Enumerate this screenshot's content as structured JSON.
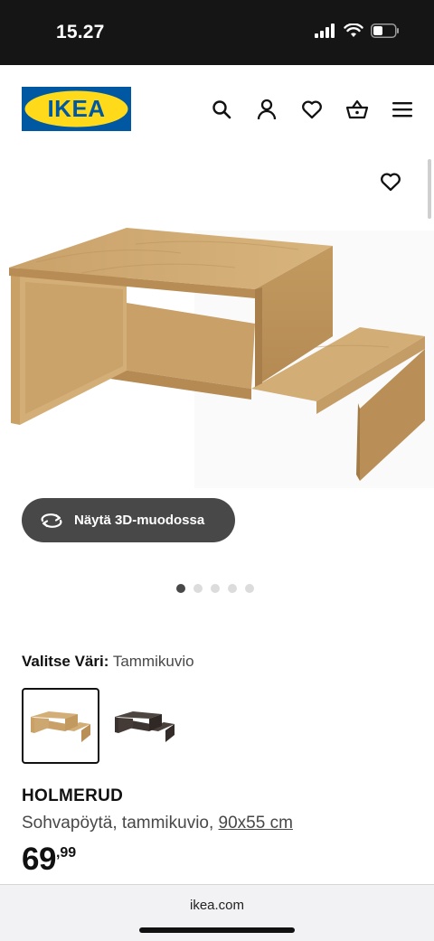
{
  "status_bar": {
    "time": "15.27"
  },
  "header": {
    "logo_text": "IKEA",
    "brand_colors": {
      "blue": "#0058a3",
      "yellow": "#ffda1a"
    }
  },
  "gallery": {
    "view_3d_label": "Näytä 3D-muodossa",
    "total_images": 5,
    "active_index": 0
  },
  "color_select": {
    "label": "Valitse Väri:",
    "value": "Tammikuvio"
  },
  "product": {
    "name": "HOLMERUD",
    "description": "Sohvapöytä, tammikuvio,",
    "dimensions": "90x55 cm",
    "price_integer": "69",
    "price_decimal": ",99"
  },
  "browser": {
    "url": "ikea.com"
  }
}
